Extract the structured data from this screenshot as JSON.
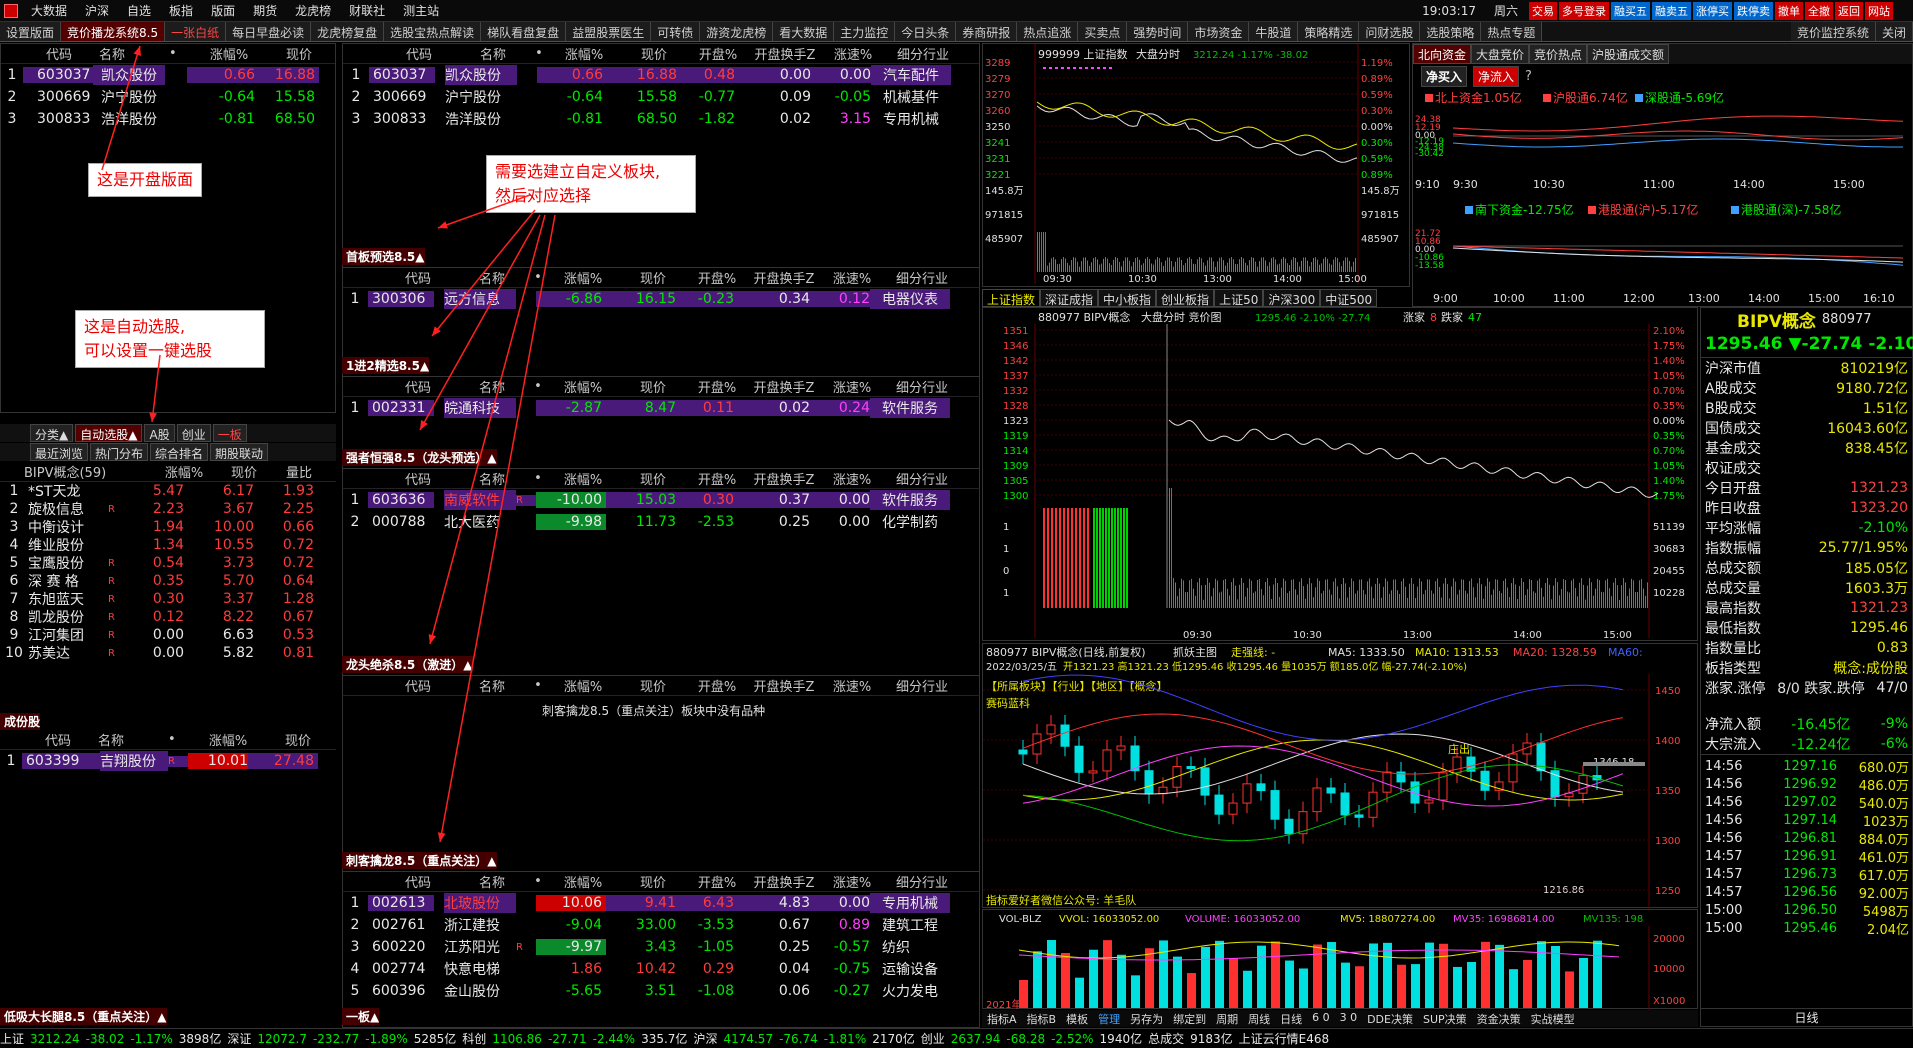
{
  "menu": [
    "大数据",
    "沪深",
    "自选",
    "板指",
    "版面",
    "期货",
    "龙虎榜",
    "财联社",
    "测主站"
  ],
  "menu_right": [
    "交易",
    "多号登录",
    "融买五",
    "融卖五",
    "涨停买",
    "跌停卖",
    "撤单",
    "全撤",
    "返回",
    "网站"
  ],
  "clock": "19:03:17",
  "weekday": "周六",
  "tabs": [
    "设置版面",
    "竞价播龙系统8.5",
    "一张白纸",
    "每日早盘必读",
    "龙虎榜复盘",
    "选股宝热点解读",
    "梯队看盘复盘",
    "益盟股票医生",
    "可转债",
    "游资龙虎榜",
    "看大数据",
    "主力监控",
    "今日头条",
    "券商研报",
    "热点追涨",
    "买卖点",
    "强势时间",
    "市场资金",
    "牛股道",
    "策略精选",
    "问财选股",
    "选股策略",
    "热点专题"
  ],
  "tab_right": [
    "竞价监控系统",
    "关闭"
  ],
  "cols_top": [
    "代码",
    "名称",
    "•",
    "涨幅%",
    "现价"
  ],
  "cols_full": [
    "代码",
    "名称",
    "•",
    "涨幅%",
    "现价",
    "开盘%",
    "开盘换手Z",
    "涨速%",
    "细分行业"
  ],
  "left_top": [
    {
      "n": "1",
      "code": "603037",
      "name": "凯众股份",
      "pct": "0.66",
      "price": "16.88"
    },
    {
      "n": "2",
      "code": "300669",
      "name": "沪宁股份",
      "pct": "-0.64",
      "price": "15.58"
    },
    {
      "n": "3",
      "code": "300833",
      "name": "浩洋股份",
      "pct": "-0.81",
      "price": "68.50"
    }
  ],
  "annotations": {
    "a1": "这是开盘版面",
    "a2": "这是自动选股,\n可以设置一键选股",
    "a3": "需要选建立自定义板块,\n然后对应选择"
  },
  "left_tabs": [
    "分类▲",
    "自动选股▲",
    "A股",
    "创业",
    "一板"
  ],
  "left_tabs2": [
    "最近浏览",
    "热门分布",
    "综合排名",
    "期股联动"
  ],
  "bipv_header": [
    "BIPV概念(59)",
    "涨幅%",
    "现价",
    "量比"
  ],
  "bipv_rows": [
    {
      "n": "1",
      "name": "*ST天龙",
      "r": "",
      "pct": "5.47",
      "price": "6.17",
      "vr": "1.93"
    },
    {
      "n": "2",
      "name": "旋极信息",
      "r": "R",
      "pct": "2.23",
      "price": "3.67",
      "vr": "2.25"
    },
    {
      "n": "3",
      "name": "中衡设计",
      "r": "",
      "pct": "1.94",
      "price": "10.00",
      "vr": "0.66"
    },
    {
      "n": "4",
      "name": "维业股份",
      "r": "",
      "pct": "1.34",
      "price": "10.55",
      "vr": "0.72"
    },
    {
      "n": "5",
      "name": "宝鹰股份",
      "r": "R",
      "pct": "0.54",
      "price": "3.73",
      "vr": "0.72"
    },
    {
      "n": "6",
      "name": "深 赛 格",
      "r": "R",
      "pct": "0.35",
      "price": "5.70",
      "vr": "0.64"
    },
    {
      "n": "7",
      "name": "东旭蓝天",
      "r": "R",
      "pct": "0.30",
      "price": "3.37",
      "vr": "1.28"
    },
    {
      "n": "8",
      "name": "凯龙股份",
      "r": "R",
      "pct": "0.12",
      "price": "8.22",
      "vr": "0.67"
    },
    {
      "n": "9",
      "name": "江河集团",
      "r": "R",
      "pct": "0.00",
      "price": "6.63",
      "vr": "0.53"
    },
    {
      "n": "10",
      "name": "苏美达",
      "r": "R",
      "pct": "0.00",
      "price": "5.82",
      "vr": "0.81"
    }
  ],
  "chengfen_title": "成份股",
  "chengfen_row": {
    "n": "1",
    "code": "603399",
    "name": "吉翔股份",
    "r": "R",
    "pct": "10.01",
    "price": "27.48"
  },
  "mid_top": [
    {
      "n": "1",
      "code": "603037",
      "name": "凯众股份",
      "pct": "0.66",
      "price": "16.88",
      "open": "0.48",
      "turn": "0.00",
      "speed": "0.00",
      "ind": "汽车配件"
    },
    {
      "n": "2",
      "code": "300669",
      "name": "沪宁股份",
      "pct": "-0.64",
      "price": "15.58",
      "open": "-0.77",
      "turn": "0.09",
      "speed": "-0.05",
      "ind": "机械基件"
    },
    {
      "n": "3",
      "code": "300833",
      "name": "浩洋股份",
      "pct": "-0.81",
      "price": "68.50",
      "open": "-1.82",
      "turn": "0.02",
      "speed": "3.15",
      "ind": "专用机械"
    }
  ],
  "sec1": {
    "title": "首板预选8.5▲",
    "rows": [
      {
        "n": "1",
        "code": "300306",
        "name": "远方信息",
        "pct": "-6.86",
        "price": "16.15",
        "open": "-0.23",
        "turn": "0.34",
        "speed": "0.12",
        "ind": "电器仪表"
      }
    ]
  },
  "sec2": {
    "title": "1进2精选8.5▲",
    "rows": [
      {
        "n": "1",
        "code": "002331",
        "name": "皖通科技",
        "pct": "-2.87",
        "price": "8.47",
        "open": "0.11",
        "turn": "0.02",
        "speed": "0.24",
        "ind": "软件服务"
      }
    ]
  },
  "sec3": {
    "title": "强者恒强8.5（龙头预选）▲",
    "rows": [
      {
        "n": "1",
        "code": "603636",
        "name": "南威软件",
        "r": "R",
        "pct": "-10.00",
        "price": "15.03",
        "open": "0.30",
        "turn": "0.37",
        "speed": "0.00",
        "ind": "软件服务"
      },
      {
        "n": "2",
        "code": "000788",
        "name": "北大医药",
        "r": "",
        "pct": "-9.98",
        "price": "11.73",
        "open": "-2.53",
        "turn": "0.25",
        "speed": "0.00",
        "ind": "化学制药"
      }
    ]
  },
  "sec4": {
    "title": "龙头绝杀8.5（激进）▲",
    "empty": "刺客擒龙8.5（重点关注）板块中没有品种"
  },
  "sec5": {
    "title": "刺客擒龙8.5（重点关注）▲",
    "rows": [
      {
        "n": "1",
        "code": "002613",
        "name": "北玻股份",
        "r": "",
        "pct": "10.06",
        "price": "9.41",
        "open": "6.43",
        "turn": "4.83",
        "speed": "0.00",
        "ind": "专用机械"
      },
      {
        "n": "2",
        "code": "002761",
        "name": "浙江建投",
        "r": "",
        "pct": "-9.04",
        "price": "33.00",
        "open": "-3.53",
        "turn": "0.67",
        "speed": "0.89",
        "ind": "建筑工程"
      },
      {
        "n": "3",
        "code": "600220",
        "name": "江苏阳光",
        "r": "R",
        "pct": "-9.97",
        "price": "3.43",
        "open": "-1.05",
        "turn": "0.25",
        "speed": "-0.57",
        "ind": "纺织"
      },
      {
        "n": "4",
        "code": "002774",
        "name": "快意电梯",
        "r": "",
        "pct": "1.86",
        "price": "10.42",
        "open": "0.29",
        "turn": "0.04",
        "speed": "-0.75",
        "ind": "运输设备"
      },
      {
        "n": "5",
        "code": "600396",
        "name": "金山股份",
        "r": "",
        "pct": "-5.65",
        "price": "3.51",
        "open": "-1.08",
        "turn": "0.06",
        "speed": "-0.27",
        "ind": "火力发电"
      }
    ]
  },
  "bottom_left_title": "低吸大长腿8.5（重点关注）▲",
  "bottom_mid_title": "一板▲",
  "index_chart": {
    "title": "999999 上证指数",
    "sub": "大盘分时",
    "val": "3212.24 -1.17% -38.02",
    "y": [
      "3289",
      "3279",
      "3270",
      "3260",
      "3250",
      "3241",
      "3231",
      "3221",
      "145.8万",
      "971815",
      "485907"
    ],
    "yr": [
      "1.19%",
      "0.89%",
      "0.59%",
      "0.30%",
      "0.00%",
      "0.30%",
      "0.59%",
      "0.89%",
      "145.8万",
      "971815",
      "485907"
    ],
    "x": [
      "09:30",
      "10:30",
      "13:00",
      "14:00",
      "15:00"
    ]
  },
  "index_tabs": [
    "上证指数",
    "深证成指",
    "中小板指",
    "创业板指",
    "上证50",
    "沪深300",
    "中证500"
  ],
  "north": {
    "tabs": [
      "北向资金",
      "大盘竞价",
      "竞价热点",
      "沪股通成交额"
    ],
    "btn1": "净买入",
    "btn2": "净流入",
    "l1": "北上资金1.05亿",
    "l2": "沪股通6.74亿",
    "l3": "深股通-5.69亿",
    "y1": [
      "24.38",
      "12.19",
      "0.00",
      "-12.19",
      "-24.38",
      "-30.42"
    ],
    "x1": [
      "9:10",
      "9:30",
      "10:30",
      "11:00",
      "14:00",
      "15:00"
    ],
    "l4": "南下资金-12.75亿",
    "l5": "港股通(沪)-5.17亿",
    "l6": "港股通(深)-7.58亿",
    "y2": [
      "21.72",
      "10.86",
      "0.00",
      "-10.86",
      "-13.58"
    ],
    "x2": [
      "9:00",
      "10:00",
      "11:00",
      "12:00",
      "13:00",
      "14:00",
      "15:00",
      "16:10"
    ]
  },
  "bipv_chart": {
    "title": "880977 BIPV概念",
    "sub": "大盘分时 竞价图",
    "val": "1295.46 -2.10% -27.74",
    "zj": "涨家",
    "zj_v": "8",
    "dj": "跌家",
    "dj_v": "47",
    "y": [
      "1351",
      "1346",
      "1342",
      "1337",
      "1332",
      "1328",
      "1323",
      "1319",
      "1314",
      "1309",
      "1305",
      "1300",
      "1",
      "1",
      "0",
      "1"
    ],
    "yr": [
      "2.10%",
      "1.75%",
      "1.40%",
      "1.05%",
      "0.70%",
      "0.35%",
      "0.00%",
      "0.35%",
      "0.70%",
      "1.05%",
      "1.40%",
      "1.75%",
      "51139",
      "30683",
      "20455",
      "10228"
    ],
    "x": [
      "09:30",
      "10:30",
      "13:00",
      "14:00",
      "15:00"
    ]
  },
  "kline": {
    "title": "880977 BIPV概念(日线,前复权)",
    "sub": "抓妖主图",
    "zq": "走强线: -",
    "ma5": "MA5: 1333.50",
    "ma10": "MA10: 1313.53",
    "ma20": "MA20: 1328.59",
    "ma60": "MA60:",
    "date": "2022/03/25/五",
    "info": "开1321.23 高1321.23 低1295.46 收1295.46 量1035万 额185.0亿 幅-27.74(-2.10%)",
    "tags": "【所属板块】【行业】【地区】【概念】",
    "lbl1": "赛码蓝科",
    "lbl2": "庄出",
    "hi": "1346.18",
    "lo": "1216.86",
    "y": [
      "1450",
      "1400",
      "1350",
      "1300",
      "1250"
    ],
    "foot": "指标爱好者微信公众号: 羊毛队",
    "vol_title": "VOL-BLZ",
    "vvol": "VVOL: 16033052.00",
    "volume": "VOLUME: 16033052.00",
    "mv5": "MV5: 18807274.00",
    "mv35": "MV35: 16986814.00",
    "mv135": "MV135: 198",
    "vy": [
      "20000",
      "10000",
      "X1000"
    ],
    "year": "2021年"
  },
  "info": {
    "name": "BIPV概念",
    "code": "880977",
    "price": "1295.46",
    "chg": "▼-27.74",
    "pct": "-2.10%",
    "rows": [
      [
        "沪深市值",
        "810219亿"
      ],
      [
        "A股成交",
        "9180.72亿"
      ],
      [
        "B股成交",
        "1.51亿"
      ],
      [
        "国债成交",
        "16043.60亿"
      ],
      [
        "基金成交",
        "838.45亿"
      ],
      [
        "权证成交",
        ""
      ],
      [
        "今日开盘",
        "1321.23"
      ],
      [
        "昨日收盘",
        "1323.20"
      ],
      [
        "平均涨幅",
        "-2.10%"
      ],
      [
        "指数振幅",
        "25.77/1.95%"
      ],
      [
        "总成交额",
        "185.05亿"
      ],
      [
        "总成交量",
        "1603.3万"
      ],
      [
        "最高指数",
        "1321.23"
      ],
      [
        "最低指数",
        "1295.46"
      ],
      [
        "指数量比",
        "0.83"
      ],
      [
        "板指类型",
        "概念:成份股"
      ],
      [
        "涨家.涨停",
        "8/0 跌家.跌停",
        "47/0"
      ]
    ],
    "flow": [
      [
        "净流入额",
        "-16.45亿",
        "-9%"
      ],
      [
        "大宗流入",
        "-12.24亿",
        "-6%"
      ]
    ],
    "trades": [
      [
        "14:56",
        "1297.16",
        "680.0万"
      ],
      [
        "14:56",
        "1296.92",
        "486.0万"
      ],
      [
        "14:56",
        "1297.02",
        "540.0万"
      ],
      [
        "14:56",
        "1297.14",
        "1023万"
      ],
      [
        "14:56",
        "1296.81",
        "884.0万"
      ],
      [
        "14:57",
        "1296.91",
        "461.0万"
      ],
      [
        "14:57",
        "1296.73",
        "617.0万"
      ],
      [
        "14:57",
        "1296.56",
        "92.00万"
      ],
      [
        "15:00",
        "1296.50",
        "5498万"
      ],
      [
        "15:00",
        "1295.46",
        "2.04亿"
      ]
    ],
    "tab": "日线"
  },
  "bottom_tools": [
    "指标A",
    "指标B",
    "模板",
    "管理",
    "另存为",
    "绑定到",
    "周期",
    "周线",
    "日线",
    "6 0",
    "3 0",
    "DDE决策",
    "SUP决策",
    "资金决策",
    "实战模型"
  ],
  "status": [
    {
      "k": "上证",
      "v": "3212.24",
      "c": "-38.02",
      "p": "-1.17%",
      "a": "3898亿"
    },
    {
      "k": "深证",
      "v": "12072.7",
      "c": "-232.77",
      "p": "-1.89%",
      "a": "5285亿"
    },
    {
      "k": "科创",
      "v": "1106.86",
      "c": "-27.71",
      "p": "-2.44%",
      "a": "335.7亿"
    },
    {
      "k": "沪深",
      "v": "4174.57",
      "c": "-76.74",
      "p": "-1.81%",
      "a": "2170亿"
    },
    {
      "k": "创业",
      "v": "2637.94",
      "c": "-68.28",
      "p": "-2.52%",
      "a": "1940亿"
    }
  ],
  "status_extra": [
    "总成交",
    "9183亿",
    "上证云行情E468"
  ],
  "colors": {
    "up": "#ff3c3c",
    "down": "#00e800",
    "purple": "#4a1a7a",
    "accent": "#500000"
  }
}
